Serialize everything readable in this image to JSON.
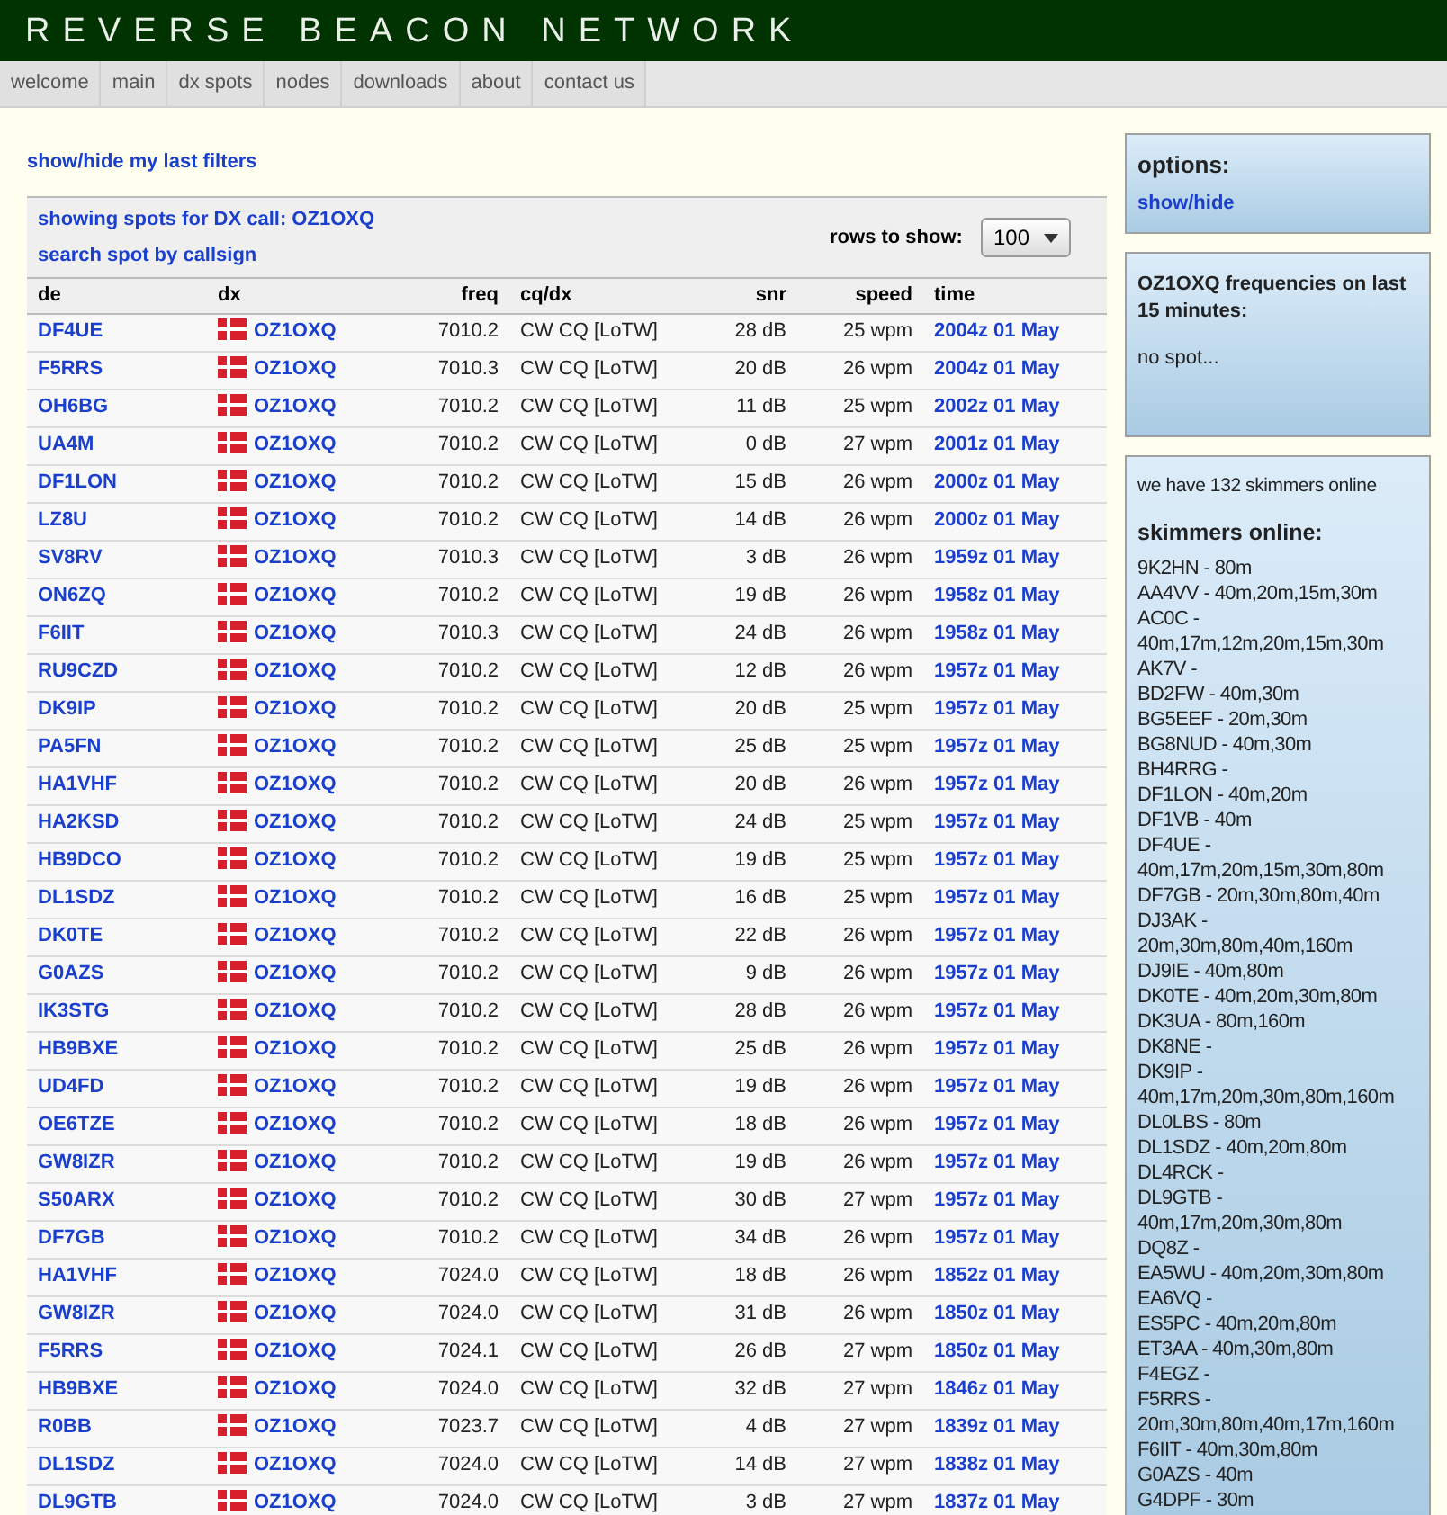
{
  "site_title": "REVERSE BEACON NETWORK",
  "nav": [
    {
      "label": "welcome",
      "selected": false
    },
    {
      "label": "main",
      "selected": false
    },
    {
      "label": "dx spots",
      "selected": false
    },
    {
      "label": "nodes",
      "selected": false
    },
    {
      "label": "downloads",
      "selected": false
    },
    {
      "label": "about",
      "selected": false
    },
    {
      "label": "contact us",
      "selected": false
    }
  ],
  "filters_link": "show/hide my last filters",
  "showing": "showing spots for DX call: OZ1OXQ",
  "search_link": "search spot by callsign",
  "rows_label": "rows to show:",
  "rows_value": "100",
  "table": {
    "columns": [
      "de",
      "dx",
      "freq",
      "cq/dx",
      "snr",
      "speed",
      "time"
    ],
    "rows": [
      [
        "DF4UE",
        "OZ1OXQ",
        "7010.2",
        "CW CQ [LoTW]",
        "28 dB",
        "25 wpm",
        "2004z 01 May"
      ],
      [
        "F5RRS",
        "OZ1OXQ",
        "7010.3",
        "CW CQ [LoTW]",
        "20 dB",
        "26 wpm",
        "2004z 01 May"
      ],
      [
        "OH6BG",
        "OZ1OXQ",
        "7010.2",
        "CW CQ [LoTW]",
        "11 dB",
        "25 wpm",
        "2002z 01 May"
      ],
      [
        "UA4M",
        "OZ1OXQ",
        "7010.2",
        "CW CQ [LoTW]",
        "0 dB",
        "27 wpm",
        "2001z 01 May"
      ],
      [
        "DF1LON",
        "OZ1OXQ",
        "7010.2",
        "CW CQ [LoTW]",
        "15 dB",
        "26 wpm",
        "2000z 01 May"
      ],
      [
        "LZ8U",
        "OZ1OXQ",
        "7010.2",
        "CW CQ [LoTW]",
        "14 dB",
        "26 wpm",
        "2000z 01 May"
      ],
      [
        "SV8RV",
        "OZ1OXQ",
        "7010.3",
        "CW CQ [LoTW]",
        "3 dB",
        "26 wpm",
        "1959z 01 May"
      ],
      [
        "ON6ZQ",
        "OZ1OXQ",
        "7010.2",
        "CW CQ [LoTW]",
        "19 dB",
        "26 wpm",
        "1958z 01 May"
      ],
      [
        "F6IIT",
        "OZ1OXQ",
        "7010.3",
        "CW CQ [LoTW]",
        "24 dB",
        "26 wpm",
        "1958z 01 May"
      ],
      [
        "RU9CZD",
        "OZ1OXQ",
        "7010.2",
        "CW CQ [LoTW]",
        "12 dB",
        "26 wpm",
        "1957z 01 May"
      ],
      [
        "DK9IP",
        "OZ1OXQ",
        "7010.2",
        "CW CQ [LoTW]",
        "20 dB",
        "25 wpm",
        "1957z 01 May"
      ],
      [
        "PA5FN",
        "OZ1OXQ",
        "7010.2",
        "CW CQ [LoTW]",
        "25 dB",
        "25 wpm",
        "1957z 01 May"
      ],
      [
        "HA1VHF",
        "OZ1OXQ",
        "7010.2",
        "CW CQ [LoTW]",
        "20 dB",
        "26 wpm",
        "1957z 01 May"
      ],
      [
        "HA2KSD",
        "OZ1OXQ",
        "7010.2",
        "CW CQ [LoTW]",
        "24 dB",
        "25 wpm",
        "1957z 01 May"
      ],
      [
        "HB9DCO",
        "OZ1OXQ",
        "7010.2",
        "CW CQ [LoTW]",
        "19 dB",
        "25 wpm",
        "1957z 01 May"
      ],
      [
        "DL1SDZ",
        "OZ1OXQ",
        "7010.2",
        "CW CQ [LoTW]",
        "16 dB",
        "25 wpm",
        "1957z 01 May"
      ],
      [
        "DK0TE",
        "OZ1OXQ",
        "7010.2",
        "CW CQ [LoTW]",
        "22 dB",
        "26 wpm",
        "1957z 01 May"
      ],
      [
        "G0AZS",
        "OZ1OXQ",
        "7010.2",
        "CW CQ [LoTW]",
        "9 dB",
        "26 wpm",
        "1957z 01 May"
      ],
      [
        "IK3STG",
        "OZ1OXQ",
        "7010.2",
        "CW CQ [LoTW]",
        "28 dB",
        "26 wpm",
        "1957z 01 May"
      ],
      [
        "HB9BXE",
        "OZ1OXQ",
        "7010.2",
        "CW CQ [LoTW]",
        "25 dB",
        "26 wpm",
        "1957z 01 May"
      ],
      [
        "UD4FD",
        "OZ1OXQ",
        "7010.2",
        "CW CQ [LoTW]",
        "19 dB",
        "26 wpm",
        "1957z 01 May"
      ],
      [
        "OE6TZE",
        "OZ1OXQ",
        "7010.2",
        "CW CQ [LoTW]",
        "18 dB",
        "26 wpm",
        "1957z 01 May"
      ],
      [
        "GW8IZR",
        "OZ1OXQ",
        "7010.2",
        "CW CQ [LoTW]",
        "19 dB",
        "26 wpm",
        "1957z 01 May"
      ],
      [
        "S50ARX",
        "OZ1OXQ",
        "7010.2",
        "CW CQ [LoTW]",
        "30 dB",
        "27 wpm",
        "1957z 01 May"
      ],
      [
        "DF7GB",
        "OZ1OXQ",
        "7010.2",
        "CW CQ [LoTW]",
        "34 dB",
        "26 wpm",
        "1957z 01 May"
      ],
      [
        "HA1VHF",
        "OZ1OXQ",
        "7024.0",
        "CW CQ [LoTW]",
        "18 dB",
        "26 wpm",
        "1852z 01 May"
      ],
      [
        "GW8IZR",
        "OZ1OXQ",
        "7024.0",
        "CW CQ [LoTW]",
        "31 dB",
        "26 wpm",
        "1850z 01 May"
      ],
      [
        "F5RRS",
        "OZ1OXQ",
        "7024.1",
        "CW CQ [LoTW]",
        "26 dB",
        "27 wpm",
        "1850z 01 May"
      ],
      [
        "HB9BXE",
        "OZ1OXQ",
        "7024.0",
        "CW CQ [LoTW]",
        "32 dB",
        "27 wpm",
        "1846z 01 May"
      ],
      [
        "R0BB",
        "OZ1OXQ",
        "7023.7",
        "CW CQ [LoTW]",
        "4 dB",
        "27 wpm",
        "1839z 01 May"
      ],
      [
        "DL1SDZ",
        "OZ1OXQ",
        "7024.0",
        "CW CQ [LoTW]",
        "14 dB",
        "27 wpm",
        "1838z 01 May"
      ],
      [
        "DL9GTB",
        "OZ1OXQ",
        "7024.0",
        "CW CQ [LoTW]",
        "3 dB",
        "27 wpm",
        "1837z 01 May"
      ]
    ]
  },
  "options": {
    "title": "options:",
    "link": "show/hide"
  },
  "frequencies": {
    "title": "OZ1OXQ frequencies on last 15 minutes:",
    "text": "no spot..."
  },
  "skimmers": {
    "count_text": "we have 132 skimmers online",
    "title": "skimmers online:",
    "items": [
      "9K2HN - 80m",
      "AA4VV - 40m,20m,15m,30m",
      "AC0C - 40m,17m,12m,20m,15m,30m",
      "AK7V -",
      "BD2FW - 40m,30m",
      "BG5EEF - 20m,30m",
      "BG8NUD - 40m,30m",
      "BH4RRG -",
      "DF1LON - 40m,20m",
      "DF1VB - 40m",
      "DF4UE - 40m,17m,20m,15m,30m,80m",
      "DF7GB - 20m,30m,80m,40m",
      "DJ3AK - 20m,30m,80m,40m,160m",
      "DJ9IE - 40m,80m",
      "DK0TE - 40m,20m,30m,80m",
      "DK3UA - 80m,160m",
      "DK8NE -",
      "DK9IP - 40m,17m,20m,30m,80m,160m",
      "DL0LBS - 80m",
      "DL1SDZ - 40m,20m,80m",
      "DL4RCK -",
      "DL9GTB - 40m,17m,20m,30m,80m",
      "DQ8Z -",
      "EA5WU - 40m,20m,30m,80m",
      "EA6VQ -",
      "ES5PC - 40m,20m,80m",
      "ET3AA - 40m,30m,80m",
      "F4EGZ -",
      "F5RRS - 20m,30m,80m,40m,17m,160m",
      "F6IIT - 40m,30m,80m",
      "G0AZS - 40m",
      "G4DPF - 30m"
    ]
  }
}
